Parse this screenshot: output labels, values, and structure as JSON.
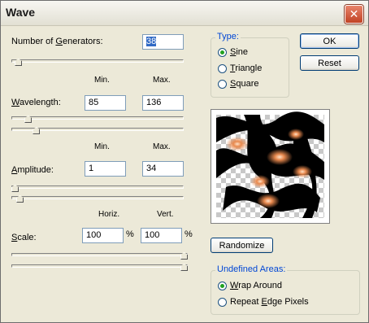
{
  "window": {
    "title": "Wave",
    "close_symbol": "✕"
  },
  "generators": {
    "label_pre": "Number of ",
    "label_u": "G",
    "label_post": "enerators:",
    "value": "38"
  },
  "columns": {
    "min": "Min.",
    "max": "Max.",
    "horiz": "Horiz.",
    "vert": "Vert."
  },
  "wavelength": {
    "label_u": "W",
    "label_post": "avelength:",
    "min": "85",
    "max": "136"
  },
  "amplitude": {
    "label_u": "A",
    "label_post": "mplitude:",
    "min": "1",
    "max": "34"
  },
  "scale": {
    "label_u": "S",
    "label_post": "cale:",
    "horiz": "100",
    "vert": "100",
    "unit": "%"
  },
  "type": {
    "title": "Type:",
    "options": [
      {
        "u": "S",
        "rest": "ine",
        "selected": true
      },
      {
        "u": "T",
        "rest": "riangle",
        "selected": false
      },
      {
        "u": "S",
        "rest": "quare",
        "selected": false
      }
    ]
  },
  "buttons": {
    "ok": "OK",
    "reset": "Reset",
    "randomize": "Randomize"
  },
  "undefined_areas": {
    "title": "Undefined Areas:",
    "options": [
      {
        "u": "W",
        "rest": "rap Around",
        "selected": true
      },
      {
        "pre": "Repeat ",
        "u": "E",
        "rest": "dge Pixels",
        "selected": false
      }
    ]
  },
  "sliders": {
    "generators": 0.02,
    "wavelength_min": 0.08,
    "wavelength_max": 0.13,
    "amplitude_min": 0.0,
    "amplitude_max": 0.03,
    "scale_horiz": 1.0,
    "scale_vert": 1.0
  }
}
